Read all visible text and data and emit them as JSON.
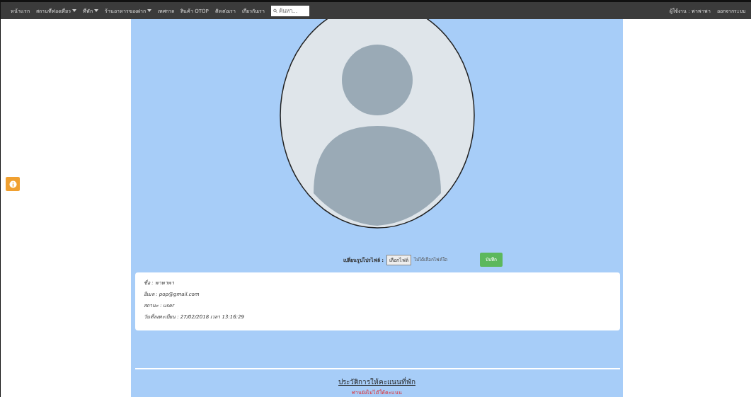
{
  "navbar": {
    "items": [
      {
        "label": "หน้าแรก",
        "dropdown": false
      },
      {
        "label": "สถานที่ท่องเที่ยว",
        "dropdown": true
      },
      {
        "label": "ที่พัก",
        "dropdown": true
      },
      {
        "label": "ร้านอาหารของฝาก",
        "dropdown": true
      },
      {
        "label": "เทศกาล",
        "dropdown": false
      },
      {
        "label": "สินค้า OTOP",
        "dropdown": false
      },
      {
        "label": "ติดต่อเรา",
        "dropdown": false
      },
      {
        "label": "เกี่ยวกับเรา",
        "dropdown": false
      }
    ],
    "search": {
      "placeholder": "ค้นหา..."
    },
    "user": "ผู้ใช้งาน : พาพาพา",
    "logout": "ออกจากระบบ"
  },
  "profile_upload": {
    "label": "เปลี่ยนรูปโปรไฟล์ :",
    "choose_button": "เลือกไฟล์",
    "no_file": "ไม่ได้เลือกไฟล์ใด",
    "save_button": "บันทึก"
  },
  "info": [
    {
      "label": "ชื่อ :",
      "value": "พาพาพา"
    },
    {
      "label": "อีเมล :",
      "value": "pop@gmail.com"
    },
    {
      "label": "สถานะ :",
      "value": "user"
    },
    {
      "label": "วันที่ลงทะเบียน :",
      "value": "27/02/2018 เวลา 13:16:29"
    }
  ],
  "history": {
    "title": "ประวัติการให้คะแนนที่พัก",
    "message": "ท่านยังไม่ได้ให้คะแนน"
  }
}
